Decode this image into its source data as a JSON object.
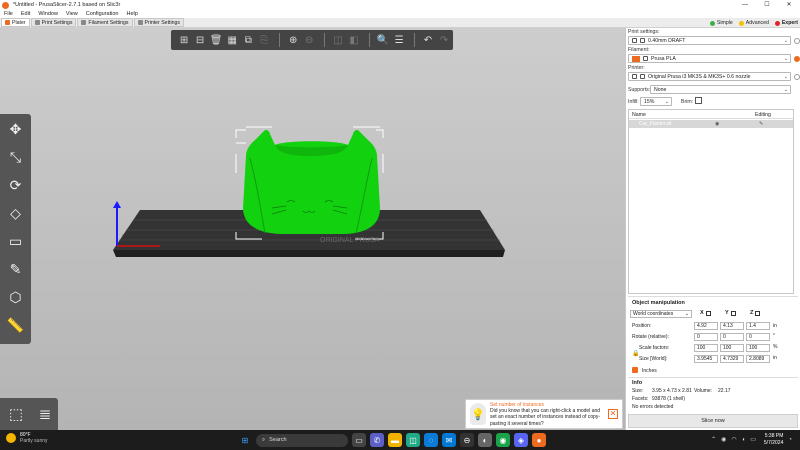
{
  "window": {
    "title": "*Untitled - PrusaSlicer-2.7.1 based on Slic3r",
    "minimize": "—",
    "maximize": "☐",
    "close": "✕"
  },
  "menu": [
    "File",
    "Edit",
    "Window",
    "View",
    "Configuration",
    "Help"
  ],
  "tabs": [
    {
      "label": "Plater",
      "active": true
    },
    {
      "label": "Print Settings",
      "active": false
    },
    {
      "label": "Filament Settings",
      "active": false
    },
    {
      "label": "Printer Settings",
      "active": false
    }
  ],
  "modes": [
    {
      "label": "Simple",
      "color": "#3bb143"
    },
    {
      "label": "Advanced",
      "color": "#f3c300"
    },
    {
      "label": "Expert",
      "color": "#e3242b"
    }
  ],
  "toolbar": {
    "icons": [
      "add-icon",
      "delete-icon",
      "delete-all-icon",
      "arrange-icon",
      "copy-icon",
      "paste-icon",
      "add-instance-icon",
      "remove-instance-icon",
      "split-objects-icon",
      "split-parts-icon",
      "search-icon",
      "layers-editing-icon",
      "undo-icon",
      "redo-icon"
    ]
  },
  "left_toolbar": {
    "icons": [
      "move-icon",
      "scale-icon",
      "rotate-icon",
      "place-on-face-icon",
      "cut-icon",
      "support-paint-icon",
      "seam-paint-icon",
      "measure-icon"
    ]
  },
  "bottom_toolbar": {
    "icons": [
      "3d-view-icon",
      "preview-icon"
    ]
  },
  "scene": {
    "model_color": "#12d10f",
    "bed_color": "#2d2d2d"
  },
  "sidebar": {
    "print_settings_label": "Print settings:",
    "print_settings_value": "0.40mm DRAFT",
    "filament_label": "Filament:",
    "filament_value": "Prusa PLA",
    "filament_color": "#ed6b21",
    "printer_label": "Printer:",
    "printer_value": "Original Prusa i3 MK3S & MK3S+ 0.6 nozzle",
    "supports_label": "Supports:",
    "supports_value": "None",
    "infill_label": "Infill:",
    "infill_value": "15%",
    "brim_label": "Brim:"
  },
  "object_list": {
    "col_name": "Name",
    "col_editing": "Editing",
    "rows": [
      {
        "name": "Cat_Planter.stl"
      }
    ]
  },
  "manipulation": {
    "title": "Object manipulation",
    "coords": "World coordinates",
    "axes": [
      "X",
      "Y",
      "Z"
    ],
    "position_label": "Position:",
    "position": [
      "4.92",
      "4.13",
      "1.4"
    ],
    "position_unit": "in",
    "rotate_label": "Rotate (relative):",
    "rotate": [
      "0",
      "0",
      "0"
    ],
    "rotate_unit": "°",
    "scale_label": "Scale factors:",
    "scale": [
      "100",
      "100",
      "100"
    ],
    "scale_unit": "%",
    "size_label": "Size [World]:",
    "size": [
      "3.9545",
      "4.7329",
      "2.8089"
    ],
    "size_unit": "in",
    "inches_label": "Inches"
  },
  "info": {
    "title": "Info",
    "size_label": "Size:",
    "size_value": "3.95 x 4.73 x 2.81",
    "volume_label": "Volume:",
    "volume_value": "22.17",
    "facets_label": "Facets:",
    "facets_value": "93878 (1 shell)",
    "errors": "No errors detected"
  },
  "slice_button": "Slice now",
  "hint": {
    "title": "Set number of instances",
    "body": "Did you know that you can right-click a model and set an exact number of instances instead of copy-pasting it several times?"
  },
  "taskbar": {
    "temp": "80°F",
    "weather": "Partly sunny",
    "search": "Search",
    "time": "5:38 PM",
    "date": "5/7/2024"
  }
}
